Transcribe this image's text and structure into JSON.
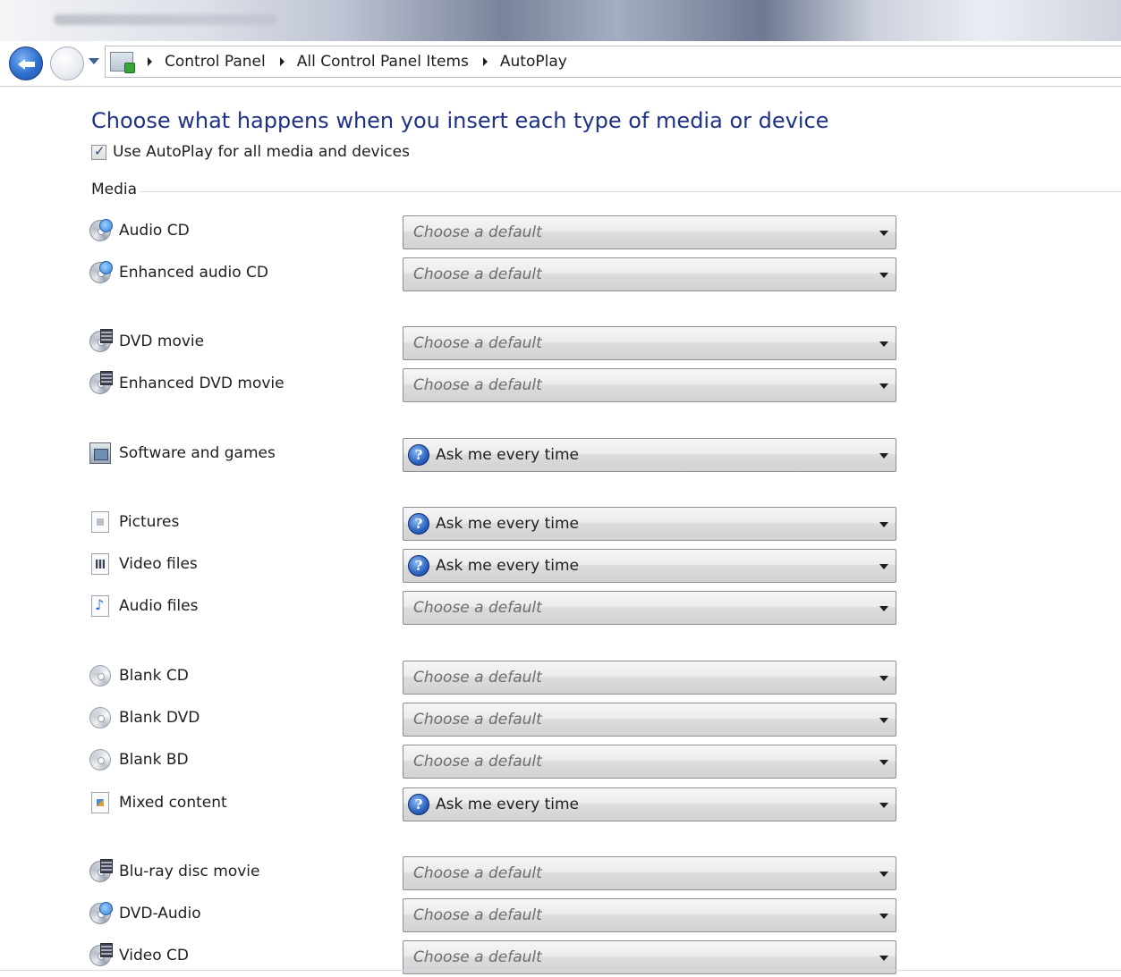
{
  "address_bar": {
    "crumbs": [
      "Control Panel",
      "All Control Panel Items",
      "AutoPlay"
    ]
  },
  "page": {
    "heading": "Choose what happens when you insert each type of media or device",
    "use_autoplay_label": "Use AutoPlay for all media and devices",
    "use_autoplay_checked": true,
    "section_media": "Media"
  },
  "items": [
    {
      "label": "Audio CD",
      "icon": "audio-cd-icon",
      "value": "Choose a default",
      "placeholder": true
    },
    {
      "label": "Enhanced audio CD",
      "icon": "audio-cd-icon",
      "value": "Choose a default",
      "placeholder": true
    },
    {
      "label": "DVD movie",
      "icon": "dvd-movie-icon",
      "value": "Choose a default",
      "placeholder": true
    },
    {
      "label": "Enhanced DVD movie",
      "icon": "dvd-movie-icon",
      "value": "Choose a default",
      "placeholder": true
    },
    {
      "label": "Software and games",
      "icon": "software-icon",
      "value": "Ask me every time",
      "placeholder": false
    },
    {
      "label": "Pictures",
      "icon": "pictures-icon",
      "value": "Ask me every time",
      "placeholder": false
    },
    {
      "label": "Video files",
      "icon": "video-files-icon",
      "value": "Ask me every time",
      "placeholder": false
    },
    {
      "label": "Audio files",
      "icon": "audio-files-icon",
      "value": "Choose a default",
      "placeholder": true
    },
    {
      "label": "Blank CD",
      "icon": "blank-disc-icon",
      "value": "Choose a default",
      "placeholder": true
    },
    {
      "label": "Blank DVD",
      "icon": "blank-disc-icon",
      "value": "Choose a default",
      "placeholder": true
    },
    {
      "label": "Blank BD",
      "icon": "blank-disc-icon",
      "value": "Choose a default",
      "placeholder": true
    },
    {
      "label": "Mixed content",
      "icon": "mixed-content-icon",
      "value": "Ask me every time",
      "placeholder": false
    },
    {
      "label": "Blu-ray disc movie",
      "icon": "blu-ray-icon",
      "value": "Choose a default",
      "placeholder": true
    },
    {
      "label": "DVD-Audio",
      "icon": "dvd-audio-icon",
      "value": "Choose a default",
      "placeholder": true
    },
    {
      "label": "Video CD",
      "icon": "video-cd-icon",
      "value": "Choose a default",
      "placeholder": true
    }
  ]
}
